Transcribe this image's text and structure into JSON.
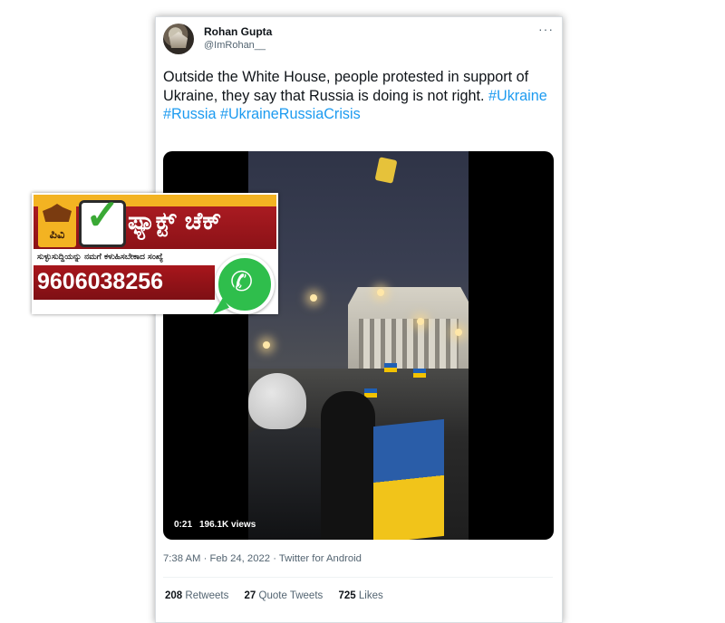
{
  "tweet": {
    "display_name": "Rohan Gupta",
    "handle": "@ImRohan__",
    "more_label": "···",
    "text": "Outside the White House, people protested in support of Ukraine, they say that Russia is doing is not right. ",
    "hashtags": [
      "#Ukraine",
      "#Russia",
      "#UkraineRussiaCrisis"
    ],
    "video": {
      "time": "0:21",
      "views": "196.1K views"
    },
    "timestamp": "7:38 AM · Feb 24, 2022 · Twitter for Android",
    "stats": {
      "retweets_count": "208",
      "retweets_label": "Retweets",
      "quotes_count": "27",
      "quotes_label": "Quote Tweets",
      "likes_count": "725",
      "likes_label": "Likes"
    }
  },
  "factcheck_banner": {
    "logo_text": "ಪಿವಿ",
    "title": "ಫ್ಯಾಕ್ಟ್ ಚೆಕ್",
    "tagline": "ಸುಳ್ಳುಸುದ್ದಿಯನ್ನು ನಮಗೆ ಕಳುಹಿಸಬೇಕಾದ ಸಂಖ್ಯೆ",
    "phone": "9606038256",
    "colors": {
      "red": "#a8161c",
      "gold": "#f3b322",
      "whatsapp": "#2fbe4c"
    }
  }
}
